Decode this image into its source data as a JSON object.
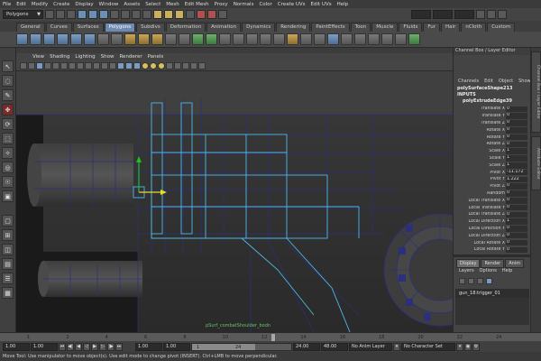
{
  "menubar": [
    "File",
    "Edit",
    "Modify",
    "Create",
    "Display",
    "Window",
    "Assets",
    "Select",
    "Mesh",
    "Edit Mesh",
    "Proxy",
    "Normals",
    "Color",
    "Create UVs",
    "Edit UVs",
    "Help"
  ],
  "statusline": {
    "mode": "Polygons"
  },
  "shelf": {
    "tabs": [
      "General",
      "Curves",
      "Surfaces",
      "Polygons",
      "Subdivs",
      "Deformation",
      "Animation",
      "Dynamics",
      "Rendering",
      "PaintEffects",
      "Toon",
      "Muscle",
      "Fluids",
      "Fur",
      "Hair",
      "nCloth",
      "Custom"
    ],
    "active_tab": "Polygons"
  },
  "viewport": {
    "menu": [
      "View",
      "Shading",
      "Lighting",
      "Show",
      "Renderer",
      "Panels"
    ],
    "label": "pSurf_combatShoulder_bodn"
  },
  "channelbox": {
    "title": "Channel Box / Layer Editor",
    "menu": [
      "Channels",
      "Edit",
      "Object",
      "Show"
    ],
    "node": "polySurfaceShape213",
    "inputs_label": "INPUTS",
    "sub_node": "polyExtrudeEdge39",
    "attributes": [
      {
        "name": "Translate X",
        "value": "0"
      },
      {
        "name": "Translate Y",
        "value": "0"
      },
      {
        "name": "Translate Z",
        "value": "0"
      },
      {
        "name": "Rotate X",
        "value": "0"
      },
      {
        "name": "Rotate Y",
        "value": "0"
      },
      {
        "name": "Rotate Z",
        "value": "0"
      },
      {
        "name": "Scale X",
        "value": "1"
      },
      {
        "name": "Scale Y",
        "value": "1"
      },
      {
        "name": "Scale Z",
        "value": "1"
      },
      {
        "name": "Pivot X",
        "value": "-11.172"
      },
      {
        "name": "Pivot Y",
        "value": "1.222"
      },
      {
        "name": "Pivot Z",
        "value": "0"
      },
      {
        "name": "Random",
        "value": "0"
      },
      {
        "name": "Local Translate X",
        "value": "0"
      },
      {
        "name": "Local Translate Y",
        "value": "0"
      },
      {
        "name": "Local Translate Z",
        "value": "0"
      },
      {
        "name": "Local Direction X",
        "value": "1"
      },
      {
        "name": "Local Direction Y",
        "value": "0"
      },
      {
        "name": "Local Direction Z",
        "value": "0"
      },
      {
        "name": "Local Rotate X",
        "value": "0"
      },
      {
        "name": "Local Rotate Y",
        "value": "0"
      }
    ],
    "layer_tabs": [
      "Display",
      "Render",
      "Anim"
    ],
    "layer_menu": [
      "Layers",
      "Options",
      "Help"
    ],
    "layer_name": "gun_18:trigger_01"
  },
  "side_tabs": [
    "Channel Box / Layer Editor",
    "Attribute Editor"
  ],
  "timeslider": {
    "ticks": [
      "1",
      "2",
      "4",
      "6",
      "8",
      "10",
      "12",
      "14",
      "16",
      "18",
      "20",
      "22",
      "24"
    ],
    "current_frame": "1.00"
  },
  "rangeslider": {
    "start": "1.00",
    "current": "1.00",
    "range_start": "1",
    "range_end": "24",
    "range_field": "24.00",
    "end": "48.00",
    "anim_layer": "No Anim Layer",
    "char_set": "No Character Set"
  },
  "helpline": "Move Tool: Use manipulator to move object(s). Use edit mode to change pivot (INSERT). Ctrl+LMB to move perpendicular."
}
